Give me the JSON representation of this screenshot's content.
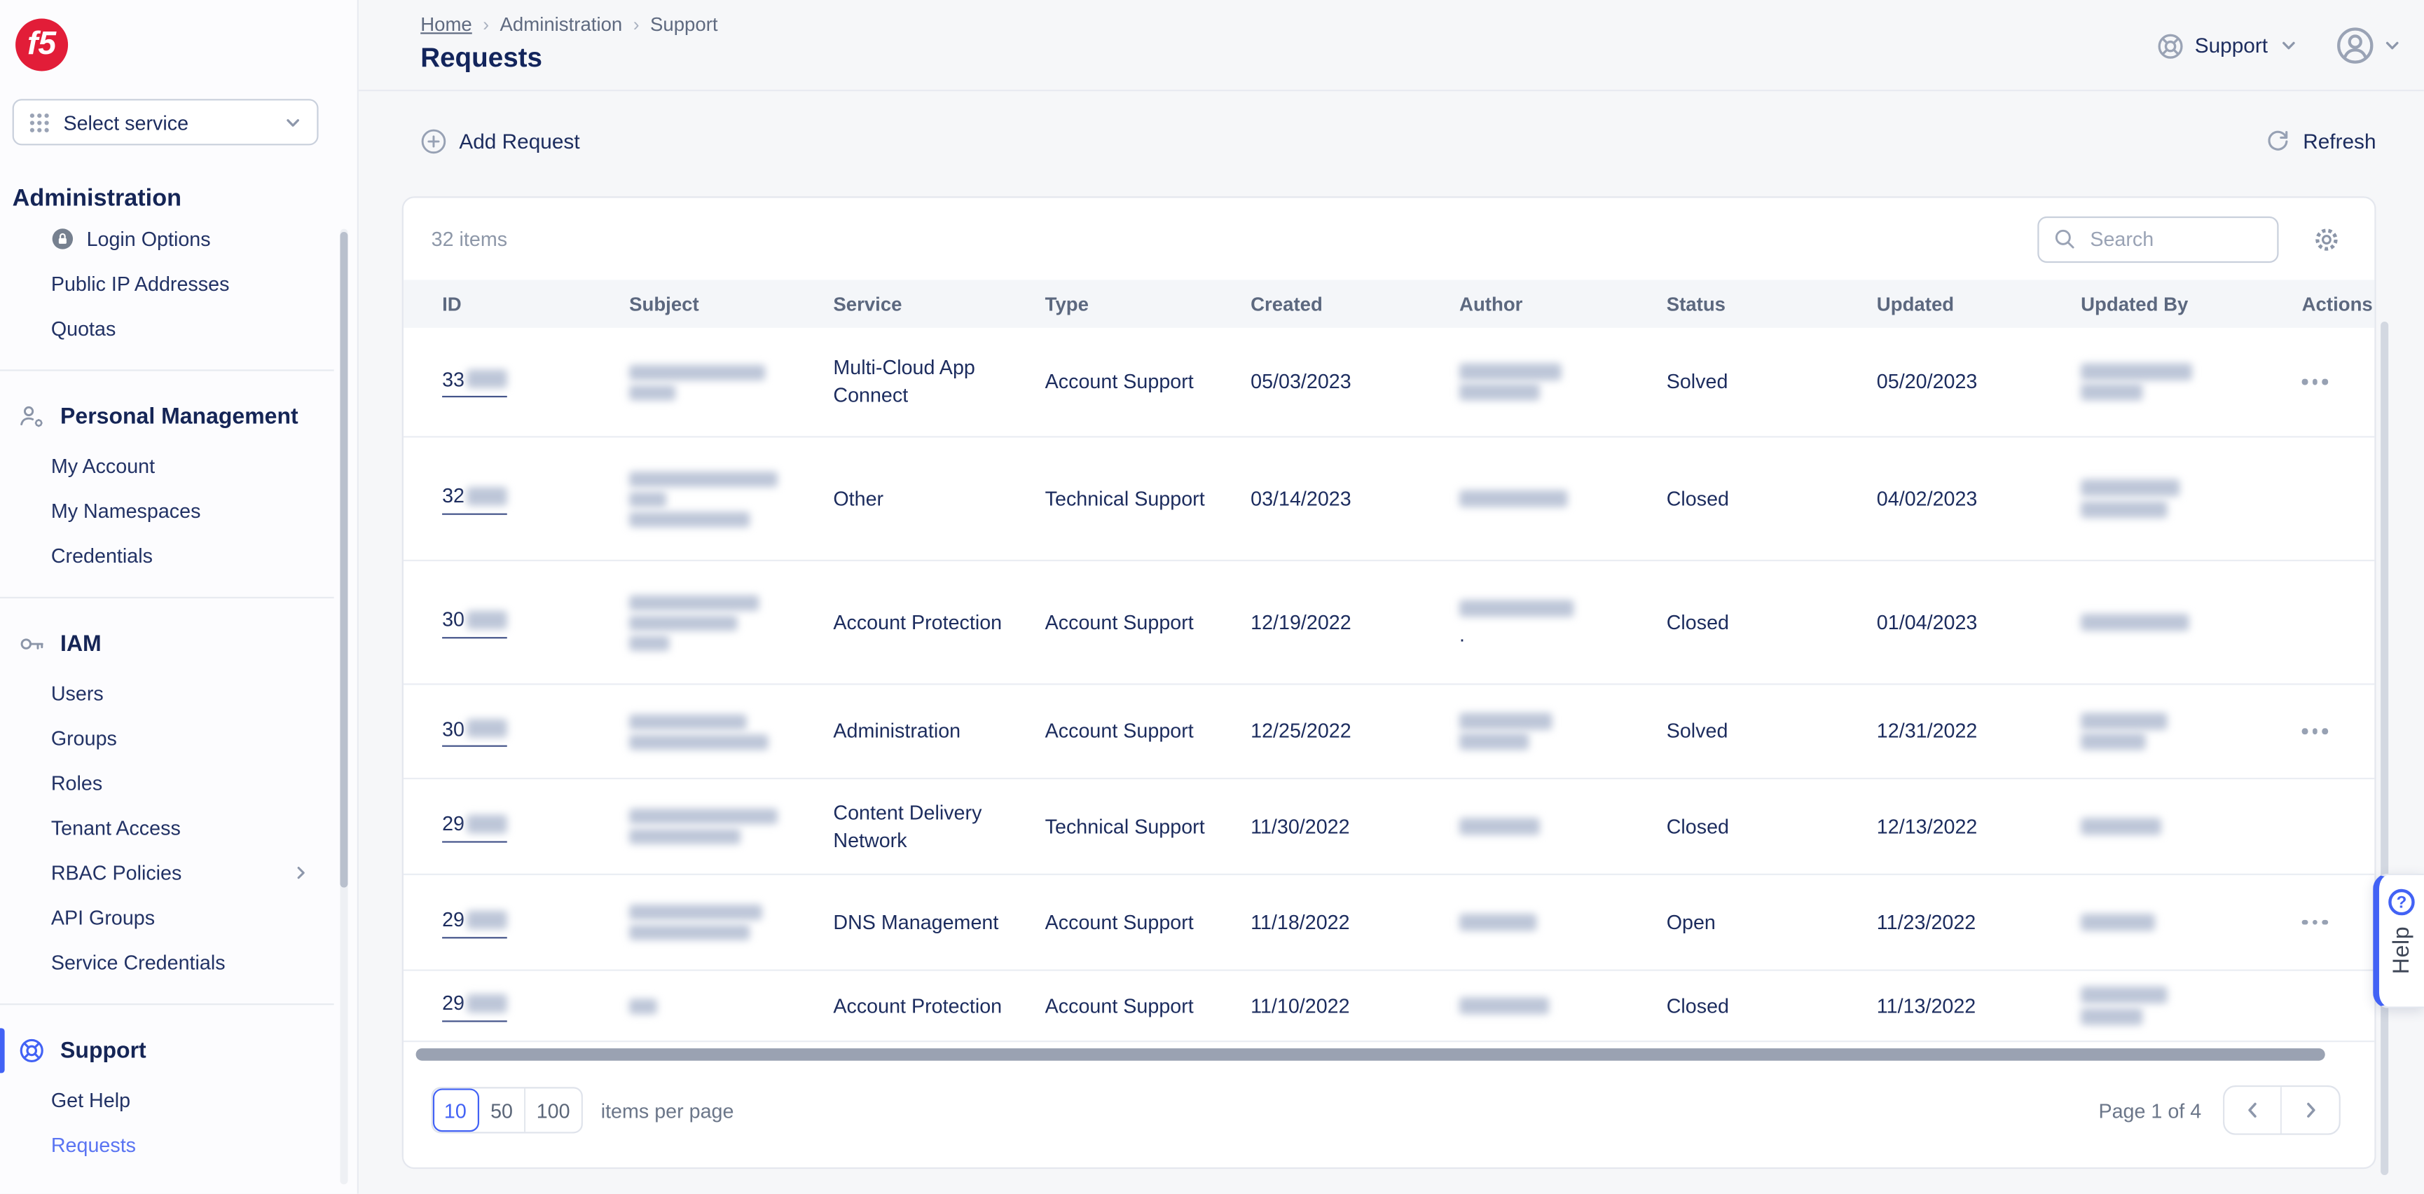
{
  "brand": {
    "logo_text": "f5"
  },
  "sidebar": {
    "service_selector": {
      "label": "Select service"
    },
    "sections": [
      {
        "kind": "service",
        "title": "Administration",
        "items": [
          {
            "label": "Login Options",
            "icon": "lock-icon"
          },
          {
            "label": "Public IP Addresses"
          },
          {
            "label": "Quotas"
          }
        ]
      },
      {
        "kind": "section",
        "title": "Personal Management",
        "icon": "person-gear-icon",
        "items": [
          {
            "label": "My Account"
          },
          {
            "label": "My Namespaces"
          },
          {
            "label": "Credentials"
          }
        ]
      },
      {
        "kind": "section",
        "title": "IAM",
        "icon": "key-icon",
        "items": [
          {
            "label": "Users"
          },
          {
            "label": "Groups"
          },
          {
            "label": "Roles"
          },
          {
            "label": "Tenant Access"
          },
          {
            "label": "RBAC Policies",
            "chevron": true
          },
          {
            "label": "API Groups"
          },
          {
            "label": "Service Credentials"
          }
        ]
      },
      {
        "kind": "section",
        "title": "Support",
        "icon": "headset-icon",
        "active": true,
        "items": [
          {
            "label": "Get Help"
          },
          {
            "label": "Requests",
            "active": true
          }
        ]
      }
    ]
  },
  "header": {
    "breadcrumb": [
      "Home",
      "Administration",
      "Support"
    ],
    "title": "Requests",
    "top_right": {
      "support_label": "Support"
    }
  },
  "toolbar": {
    "add_label": "Add Request",
    "refresh_label": "Refresh"
  },
  "table": {
    "items_count": "32 items",
    "search_placeholder": "Search",
    "columns": [
      "ID",
      "Subject",
      "Service",
      "Type",
      "Created",
      "Author",
      "Status",
      "Updated",
      "Updated By",
      "Actions"
    ],
    "rows": [
      {
        "id_prefix": "33",
        "id_redacted": true,
        "subject_redacted": true,
        "service": "Multi-Cloud App Connect",
        "type": "Account Support",
        "created": "05/03/2023",
        "author_redacted": true,
        "status": "Solved",
        "updated": "05/20/2023",
        "updated_by_redacted": true,
        "menu": true,
        "height": 71,
        "subject_redaction": [
          88,
          30
        ],
        "author_redaction": [
          66,
          52
        ],
        "updated_by_redaction": [
          72,
          40
        ]
      },
      {
        "id_prefix": "32",
        "id_redacted": true,
        "subject_redacted": true,
        "service": "Other",
        "type": "Technical Support",
        "created": "03/14/2023",
        "author_redacted": true,
        "status": "Closed",
        "updated": "04/02/2023",
        "updated_by_redacted": true,
        "menu": false,
        "height": 80,
        "subject_redaction": [
          96,
          24,
          78
        ],
        "author_redaction": [
          70
        ],
        "updated_by_redaction": [
          64,
          56
        ]
      },
      {
        "id_prefix": "30",
        "id_redacted": true,
        "subject_redacted": true,
        "service": "Account Protection",
        "type": "Account Support",
        "created": "12/19/2022",
        "author_redacted": true,
        "author_suffix": ".",
        "status": "Closed",
        "updated": "01/04/2023",
        "updated_by_redacted": true,
        "menu": false,
        "height": 80,
        "subject_redaction": [
          84,
          70,
          26
        ],
        "author_redaction": [
          74
        ],
        "updated_by_redaction": [
          70
        ]
      },
      {
        "id_prefix": "30",
        "id_redacted": true,
        "subject_redacted": true,
        "service": "Administration",
        "type": "Account Support",
        "created": "12/25/2022",
        "author_redacted": true,
        "status": "Solved",
        "updated": "12/31/2022",
        "updated_by_redacted": true,
        "menu": true,
        "height": 61,
        "subject_redaction": [
          76,
          90
        ],
        "author_redaction": [
          60,
          45
        ],
        "updated_by_redaction": [
          56,
          42
        ]
      },
      {
        "id_prefix": "29",
        "id_redacted": true,
        "subject_redacted": true,
        "service": "Content Delivery Network",
        "type": "Technical Support",
        "created": "11/30/2022",
        "author_redacted": true,
        "status": "Closed",
        "updated": "12/13/2022",
        "updated_by_redacted": true,
        "menu": false,
        "height": 62,
        "subject_redaction": [
          96,
          72
        ],
        "author_redaction": [
          52
        ],
        "updated_by_redaction": [
          52
        ]
      },
      {
        "id_prefix": "29",
        "id_redacted": true,
        "subject_redacted": true,
        "service": "DNS Management",
        "type": "Account Support",
        "created": "11/18/2022",
        "author_redacted": true,
        "status": "Open",
        "updated": "11/23/2022",
        "updated_by_redacted": true,
        "menu": true,
        "height": 62,
        "subject_redaction": [
          86,
          78
        ],
        "author_redaction": [
          50
        ],
        "updated_by_redaction": [
          48
        ]
      },
      {
        "id_prefix": "29",
        "id_redacted": true,
        "subject_redacted": true,
        "service": "Account Protection",
        "type": "Account Support",
        "created": "11/10/2022",
        "author_redacted": true,
        "status": "Closed",
        "updated": "11/13/2022",
        "updated_by_redacted": true,
        "menu": false,
        "height": 46,
        "subject_redaction": [
          18
        ],
        "author_redaction": [
          58
        ],
        "updated_by_redaction": [
          56,
          40
        ]
      }
    ]
  },
  "pagination": {
    "sizes": [
      "10",
      "50",
      "100"
    ],
    "selected": "10",
    "label": "items per page",
    "page_label": "Page 1 of 4"
  },
  "help_tab": {
    "label": "Help"
  },
  "colors": {
    "accent_blue": "#4262f5",
    "logo_red": "#e21d38",
    "navy_text": "#1c2c5e",
    "muted_text": "#6b7689"
  }
}
